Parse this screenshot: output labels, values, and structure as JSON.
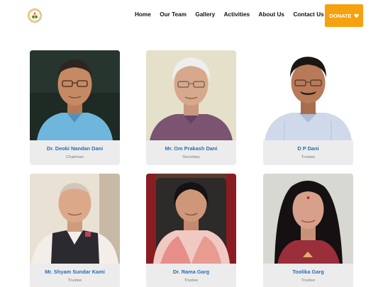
{
  "header": {
    "logo_icon": "trust-emblem-icon",
    "nav": [
      "Home",
      "Our Team",
      "Gallery",
      "Activities",
      "About Us",
      "Contact Us"
    ],
    "donate_label": "DONATE",
    "donate_icon": "heart-icon",
    "accent_color": "#f5a20e"
  },
  "team": [
    {
      "name": "Dr. Deoki Nandan Dani",
      "role": "Chairman"
    },
    {
      "name": "Mr. Om Prakash Dani",
      "role": "Secretary"
    },
    {
      "name": "D P Dani",
      "role": "Trustee"
    },
    {
      "name": "Mr. Shyam Sundar Kami",
      "role": "Trustee"
    },
    {
      "name": "Dr. Rama Garg",
      "role": "Trustee"
    },
    {
      "name": "Toolika Garg",
      "role": "Trustee"
    }
  ],
  "colors": {
    "name_text": "#2a6fb5",
    "role_text": "#7a7a7a",
    "card_bg": "#ececec"
  }
}
